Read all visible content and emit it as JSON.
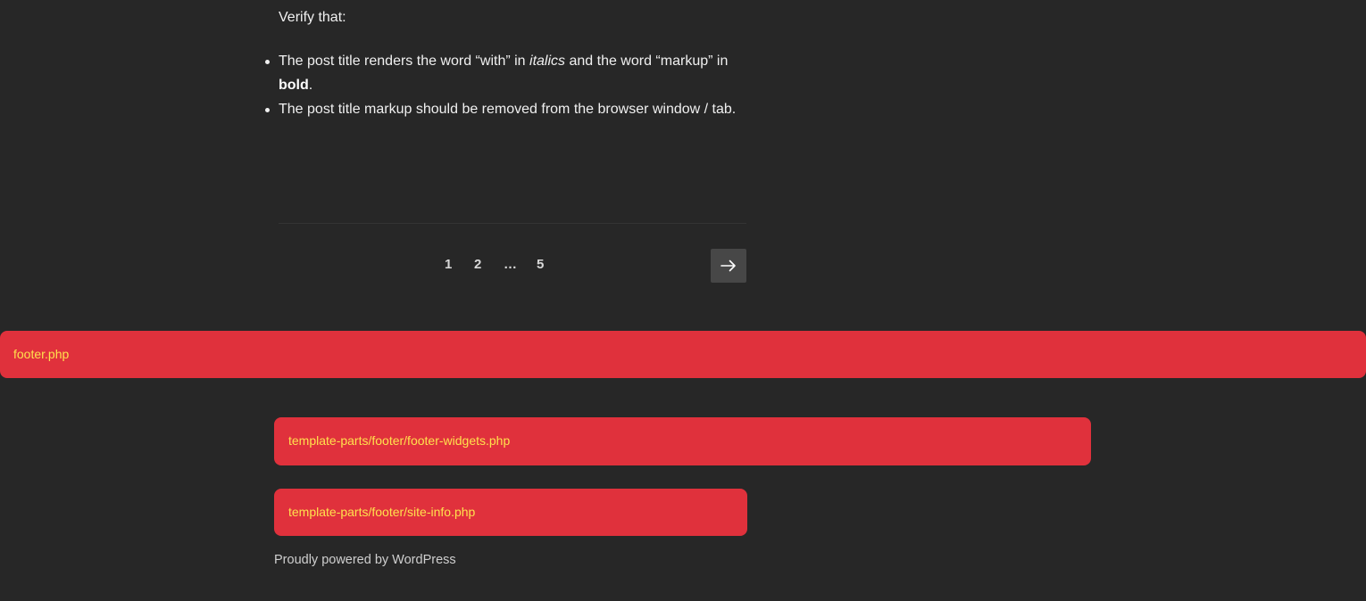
{
  "content": {
    "verify_text": "Verify that:",
    "checklist": [
      {
        "before_italic": "The post title renders the word “with” in ",
        "italic": "italics",
        "middle": " and the word “markup” in ",
        "bold": "bold",
        "after": "."
      },
      {
        "text": "The post title markup should be removed from the browser window / tab."
      }
    ]
  },
  "pagination": {
    "pages": [
      "1",
      "2",
      "…",
      "5"
    ],
    "next_icon": "arrow-right-icon"
  },
  "template_debug": {
    "footer_label": "footer.php",
    "footer_widgets_label": "template-parts/footer/footer-widgets.php",
    "site_info_label": "template-parts/footer/site-info.php",
    "color": "#e0313c",
    "text_color": "#ffe14d"
  },
  "footer": {
    "powered_by": "Proudly powered by WordPress"
  }
}
